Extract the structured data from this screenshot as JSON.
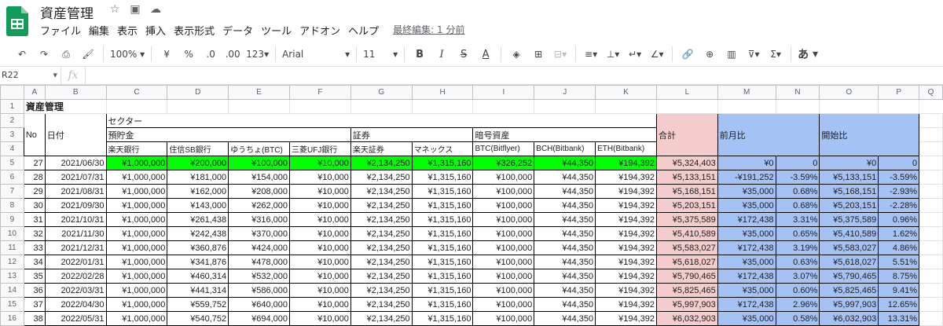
{
  "app": {
    "title": "資産管理",
    "menu": [
      "ファイル",
      "編集",
      "表示",
      "挿入",
      "表示形式",
      "データ",
      "ツール",
      "アドオン",
      "ヘルプ"
    ],
    "last_edit": "最終編集: 1 分前"
  },
  "toolbar": {
    "zoom": "100%",
    "currency": "¥",
    "percent": "%",
    "dec_less": ".0",
    "dec_more": ".00",
    "format_more": "123",
    "font": "Arial",
    "font_size": "11",
    "bold": "B",
    "italic": "I",
    "strike": "S",
    "text_color": "A",
    "input_tools": "あ"
  },
  "formula_bar": {
    "name_box": "R22",
    "fx": "fx"
  },
  "columns": [
    "A",
    "B",
    "C",
    "D",
    "E",
    "F",
    "G",
    "H",
    "I",
    "J",
    "K",
    "L",
    "M",
    "N",
    "O",
    "P",
    "Q"
  ],
  "sheet": {
    "a1_title": "資産管理",
    "sector": "セクター",
    "savings": "預貯金",
    "securities": "証券",
    "crypto": "暗号資産",
    "no_label": "No",
    "date_label": "日付",
    "total": "合計",
    "mom": "前月比",
    "since_start": "開始比",
    "sub_headers": [
      "楽天銀行",
      "住信SB銀行",
      "ゆうちょ(BTC)",
      "三菱UFJ銀行",
      "楽天証券",
      "マネックス",
      "BTC(Bitflyer)",
      "BCH(Bitbank)",
      "ETH(Bitbank)"
    ]
  },
  "rows": [
    {
      "r": "5",
      "no": "27",
      "date": "2021/06/30",
      "v": [
        "¥1,000,000",
        "¥200,000",
        "¥100,000",
        "¥10,000",
        "¥2,134,250",
        "¥1,315,160",
        "¥326,252",
        "¥44,350",
        "¥194,392"
      ],
      "total": "¥5,324,403",
      "mom": "¥0",
      "mom_pct": "0",
      "start": "¥0",
      "start_pct": "0"
    },
    {
      "r": "6",
      "no": "28",
      "date": "2021/07/31",
      "v": [
        "¥1,000,000",
        "¥181,000",
        "¥154,000",
        "¥10,000",
        "¥2,134,250",
        "¥1,315,160",
        "¥100,000",
        "¥44,350",
        "¥194,392"
      ],
      "total": "¥5,133,151",
      "mom": "-¥191,252",
      "mom_pct": "-3.59%",
      "start": "¥5,133,151",
      "start_pct": "-3.59%"
    },
    {
      "r": "7",
      "no": "29",
      "date": "2021/08/31",
      "v": [
        "¥1,000,000",
        "¥162,000",
        "¥208,000",
        "¥10,000",
        "¥2,134,250",
        "¥1,315,160",
        "¥100,000",
        "¥44,350",
        "¥194,392"
      ],
      "total": "¥5,168,151",
      "mom": "¥35,000",
      "mom_pct": "0.68%",
      "start": "¥5,168,151",
      "start_pct": "-2.93%"
    },
    {
      "r": "8",
      "no": "30",
      "date": "2021/09/30",
      "v": [
        "¥1,000,000",
        "¥143,000",
        "¥262,000",
        "¥10,000",
        "¥2,134,250",
        "¥1,315,160",
        "¥100,000",
        "¥44,350",
        "¥194,392"
      ],
      "total": "¥5,203,151",
      "mom": "¥35,000",
      "mom_pct": "0.68%",
      "start": "¥5,203,151",
      "start_pct": "-2.28%"
    },
    {
      "r": "9",
      "no": "31",
      "date": "2021/10/31",
      "v": [
        "¥1,000,000",
        "¥261,438",
        "¥316,000",
        "¥10,000",
        "¥2,134,250",
        "¥1,315,160",
        "¥100,000",
        "¥44,350",
        "¥194,392"
      ],
      "total": "¥5,375,589",
      "mom": "¥172,438",
      "mom_pct": "3.31%",
      "start": "¥5,375,589",
      "start_pct": "0.96%"
    },
    {
      "r": "10",
      "no": "32",
      "date": "2021/11/30",
      "v": [
        "¥1,000,000",
        "¥242,438",
        "¥370,000",
        "¥10,000",
        "¥2,134,250",
        "¥1,315,160",
        "¥100,000",
        "¥44,350",
        "¥194,392"
      ],
      "total": "¥5,410,589",
      "mom": "¥35,000",
      "mom_pct": "0.65%",
      "start": "¥5,410,589",
      "start_pct": "1.62%"
    },
    {
      "r": "11",
      "no": "33",
      "date": "2021/12/31",
      "v": [
        "¥1,000,000",
        "¥360,876",
        "¥424,000",
        "¥10,000",
        "¥2,134,250",
        "¥1,315,160",
        "¥100,000",
        "¥44,350",
        "¥194,392"
      ],
      "total": "¥5,583,027",
      "mom": "¥172,438",
      "mom_pct": "3.19%",
      "start": "¥5,583,027",
      "start_pct": "4.86%"
    },
    {
      "r": "12",
      "no": "34",
      "date": "2022/01/31",
      "v": [
        "¥1,000,000",
        "¥341,876",
        "¥478,000",
        "¥10,000",
        "¥2,134,250",
        "¥1,315,160",
        "¥100,000",
        "¥44,350",
        "¥194,392"
      ],
      "total": "¥5,618,027",
      "mom": "¥35,000",
      "mom_pct": "0.63%",
      "start": "¥5,618,027",
      "start_pct": "5.51%"
    },
    {
      "r": "13",
      "no": "35",
      "date": "2022/02/28",
      "v": [
        "¥1,000,000",
        "¥460,314",
        "¥532,000",
        "¥10,000",
        "¥2,134,250",
        "¥1,315,160",
        "¥100,000",
        "¥44,350",
        "¥194,392"
      ],
      "total": "¥5,790,465",
      "mom": "¥172,438",
      "mom_pct": "3.07%",
      "start": "¥5,790,465",
      "start_pct": "8.75%"
    },
    {
      "r": "14",
      "no": "36",
      "date": "2022/03/31",
      "v": [
        "¥1,000,000",
        "¥441,314",
        "¥586,000",
        "¥10,000",
        "¥2,134,250",
        "¥1,315,160",
        "¥100,000",
        "¥44,350",
        "¥194,392"
      ],
      "total": "¥5,825,465",
      "mom": "¥35,000",
      "mom_pct": "0.60%",
      "start": "¥5,825,465",
      "start_pct": "9.41%"
    },
    {
      "r": "15",
      "no": "37",
      "date": "2022/04/30",
      "v": [
        "¥1,000,000",
        "¥559,752",
        "¥640,000",
        "¥10,000",
        "¥2,134,250",
        "¥1,315,160",
        "¥100,000",
        "¥44,350",
        "¥194,392"
      ],
      "total": "¥5,997,903",
      "mom": "¥172,438",
      "mom_pct": "2.96%",
      "start": "¥5,997,903",
      "start_pct": "12.65%"
    },
    {
      "r": "16",
      "no": "38",
      "date": "2022/05/31",
      "v": [
        "¥1,000,000",
        "¥540,752",
        "¥694,000",
        "¥10,000",
        "¥2,134,250",
        "¥1,315,160",
        "¥100,000",
        "¥44,350",
        "¥194,392"
      ],
      "total": "¥6,032,903",
      "mom": "¥35,000",
      "mom_pct": "0.58%",
      "start": "¥6,032,903",
      "start_pct": "13.31%"
    }
  ]
}
